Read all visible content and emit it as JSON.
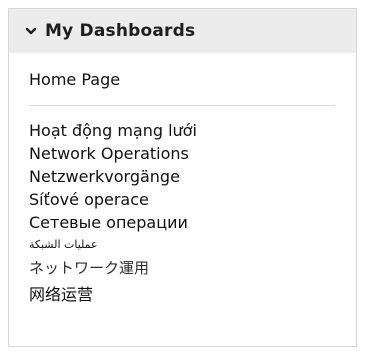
{
  "panel": {
    "title": "My Dashboards",
    "collapse_icon": "chevron-down-icon",
    "home_item": "Home Page",
    "dashboards": [
      {
        "label": "Hoạt động mạng lưới"
      },
      {
        "label": "Network Operations"
      },
      {
        "label": "Netzwerkvorgänge"
      },
      {
        "label": "Síťové operace"
      },
      {
        "label": "Сетевые операции"
      },
      {
        "label": "عمليات الشبكة"
      },
      {
        "label": "ネットワーク運用"
      },
      {
        "label": "网络运营"
      }
    ]
  }
}
